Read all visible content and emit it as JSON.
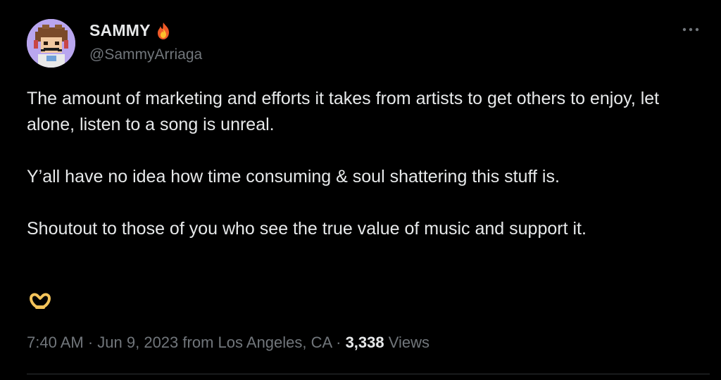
{
  "author": {
    "display_name": "SAMMY",
    "display_name_emoji": "fire-icon",
    "handle": "@SammyArriaga"
  },
  "more_icon": "more-horizontal-icon",
  "tweet": {
    "line_1": "The amount of marketing and efforts it takes from artists to get others to enjoy, let alone, listen to a song is unreal.",
    "line_2": "Y’all have no idea how time consuming & soul shattering this stuff is.",
    "line_3": "Shoutout to those of you who see the true value of music and support it.",
    "trailing_emoji": "heart-hands-icon"
  },
  "meta": {
    "time": "7:40 AM",
    "separator": "·",
    "date": "Jun 9, 2023",
    "location_prefix": "from",
    "location": "Los Angeles, CA",
    "views_count": "3,338",
    "views_label": "Views"
  },
  "colors": {
    "background": "#000000",
    "primary_text": "#e7e9ea",
    "secondary_text": "#71767b",
    "divider": "#2f3336"
  }
}
